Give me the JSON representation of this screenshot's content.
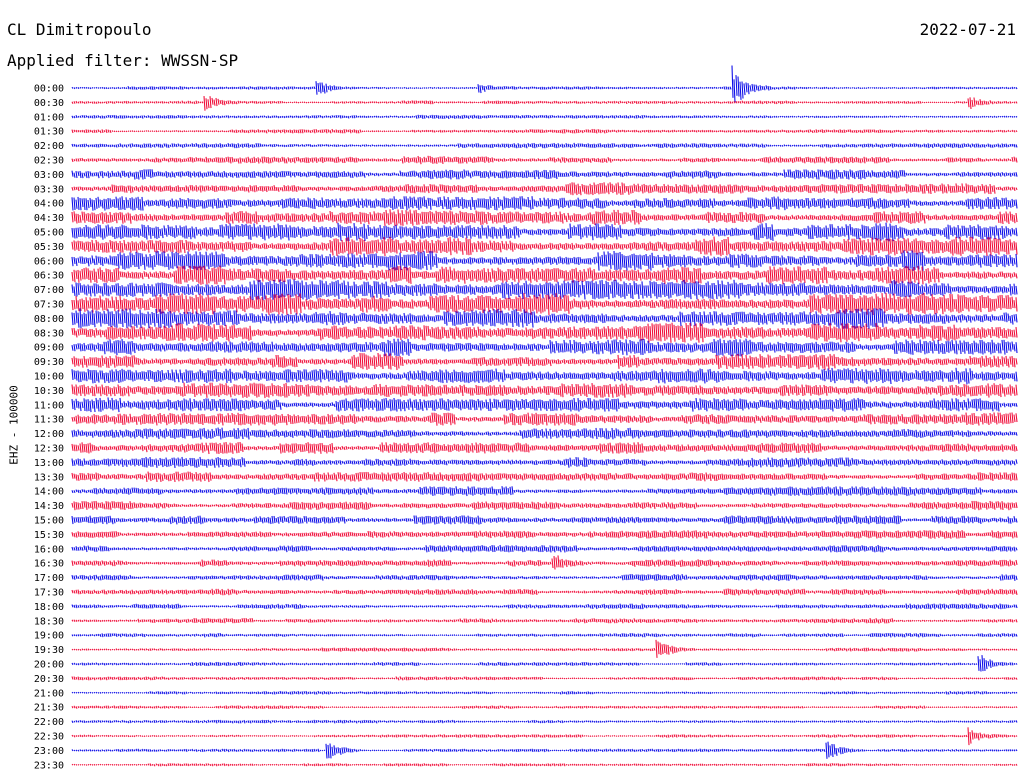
{
  "header": {
    "station": "CL Dimitropoulo",
    "date": "2022-07-21",
    "filter": "Applied filter: WWSSN-SP"
  },
  "chart_data": {
    "type": "line",
    "ylabel": "EHZ - 100000",
    "row_labels": [
      "00:00",
      "00:30",
      "01:00",
      "01:30",
      "02:00",
      "02:30",
      "03:00",
      "03:30",
      "04:00",
      "04:30",
      "05:00",
      "05:30",
      "06:00",
      "06:30",
      "07:00",
      "07:30",
      "08:00",
      "08:30",
      "09:00",
      "09:30",
      "10:00",
      "10:30",
      "11:00",
      "11:30",
      "12:00",
      "12:30",
      "13:00",
      "13:30",
      "14:00",
      "14:30",
      "15:00",
      "15:30",
      "16:00",
      "16:30",
      "17:00",
      "17:30",
      "18:00",
      "18:30",
      "19:00",
      "19:30",
      "20:00",
      "20:30",
      "21:00",
      "21:30",
      "22:00",
      "22:30",
      "23:00",
      "23:30"
    ],
    "colors": [
      "#1010e8",
      "#f0103c"
    ],
    "relative_amplitude": [
      0.35,
      0.4,
      0.45,
      0.45,
      0.55,
      0.85,
      1.1,
      1.3,
      1.5,
      1.7,
      1.9,
      2.0,
      2.1,
      2.1,
      2.2,
      2.2,
      2.1,
      2.0,
      1.9,
      1.8,
      1.7,
      1.6,
      1.5,
      1.4,
      1.3,
      1.2,
      1.1,
      1.05,
      1.0,
      0.95,
      0.95,
      0.9,
      0.85,
      0.8,
      0.75,
      0.7,
      0.6,
      0.55,
      0.45,
      0.42,
      0.4,
      0.4,
      0.38,
      0.36,
      0.35,
      0.34,
      0.33,
      0.32
    ],
    "events": [
      {
        "row": 0,
        "position": 0.7,
        "strength": 7.0,
        "label": ""
      },
      {
        "row": 0,
        "position": 0.26,
        "strength": 2.2,
        "label": ""
      },
      {
        "row": 0,
        "position": 0.43,
        "strength": 1.8,
        "label": ""
      },
      {
        "row": 1,
        "position": 0.14,
        "strength": 2.5,
        "label": ""
      },
      {
        "row": 1,
        "position": 0.95,
        "strength": 2.0,
        "label": ""
      },
      {
        "row": 33,
        "position": 0.51,
        "strength": 3.0,
        "label": ""
      },
      {
        "row": 39,
        "position": 0.62,
        "strength": 3.0,
        "label": ""
      },
      {
        "row": 40,
        "position": 0.96,
        "strength": 3.5,
        "label": ""
      },
      {
        "row": 46,
        "position": 0.27,
        "strength": 4.0,
        "label": ""
      },
      {
        "row": 46,
        "position": 0.8,
        "strength": 3.5,
        "label": ""
      },
      {
        "row": 45,
        "position": 0.95,
        "strength": 2.5,
        "label": ""
      }
    ]
  }
}
